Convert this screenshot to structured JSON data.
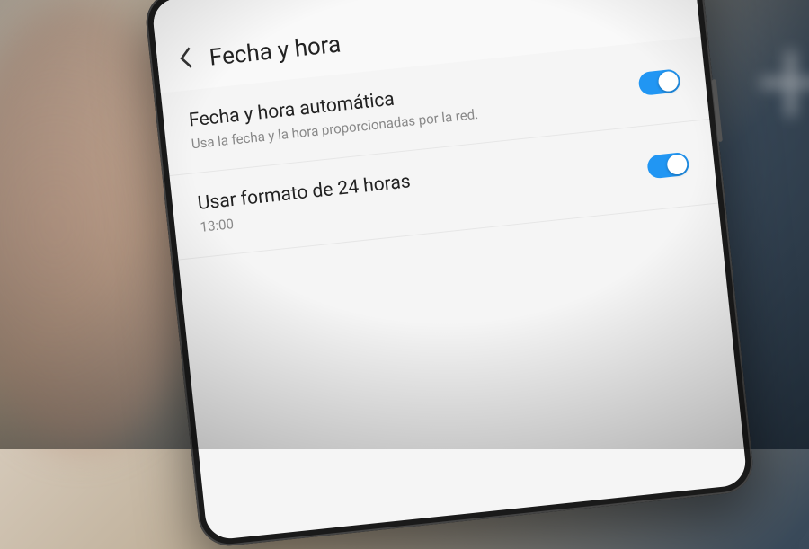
{
  "header": {
    "title": "Fecha y hora"
  },
  "settings": [
    {
      "title": "Fecha y hora automática",
      "subtitle": "Usa la fecha y la hora proporcionadas por la red.",
      "enabled": true
    },
    {
      "title": "Usar formato de 24 horas",
      "subtitle": "13:00",
      "enabled": true
    }
  ]
}
